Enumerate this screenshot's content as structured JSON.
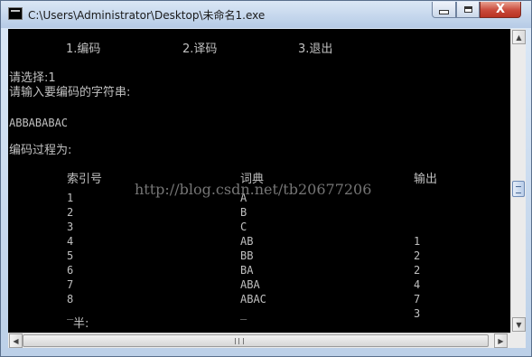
{
  "window": {
    "title": "C:\\Users\\Administrator\\Desktop\\未命名1.exe",
    "close_symbol": "X",
    "minimize_icon": "minimize-icon",
    "maximize_icon": "maximize-icon"
  },
  "console": {
    "menu": [
      "1.编码",
      "2.译码",
      "3.退出"
    ],
    "prompt_choice": "请选择:1",
    "prompt_input": "请输入要编码的字符串:",
    "input_string": "ABBABABAC",
    "process_label": "编码过程为:",
    "headers": {
      "index": "索引号",
      "dict": "词典",
      "output": "输出"
    },
    "rows": [
      {
        "index": "1",
        "dict": "A",
        "output": ""
      },
      {
        "index": "2",
        "dict": "B",
        "output": ""
      },
      {
        "index": "3",
        "dict": "C",
        "output": ""
      },
      {
        "index": "4",
        "dict": "AB",
        "output": "1"
      },
      {
        "index": "5",
        "dict": "BB",
        "output": "2"
      },
      {
        "index": "6",
        "dict": "BA",
        "output": "2"
      },
      {
        "index": "7",
        "dict": "ABA",
        "output": "4"
      },
      {
        "index": "8",
        "dict": "ABAC",
        "output": "7"
      },
      {
        "index": "_",
        "dict": "_",
        "output": "3"
      }
    ],
    "cut_off_text": "半:",
    "watermark": "http://blog.csdn.net/tb20677206"
  },
  "scrollbars": {
    "up_arrow": "▲",
    "down_arrow": "▼",
    "left_arrow": "◀",
    "right_arrow": "▶"
  }
}
